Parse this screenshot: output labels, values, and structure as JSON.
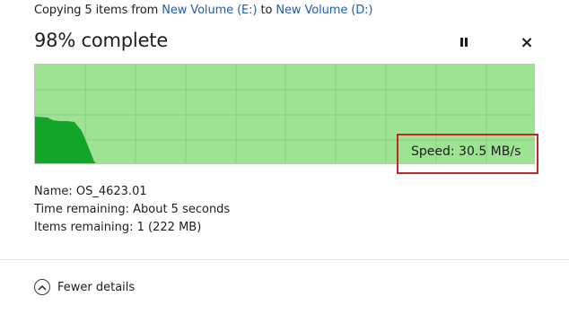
{
  "header": {
    "prefix": "Copying 5 items from",
    "source": "New Volume (E:)",
    "middle": "to",
    "destination": "New Volume (D:)"
  },
  "progress": {
    "label": "98% complete",
    "value": 0.98
  },
  "controls": {
    "pause_icon": "pause-icon",
    "close_icon": "close-icon",
    "close_glyph": "×"
  },
  "graph": {
    "speed_label": "Speed: 30.5 MB/s",
    "fill_color": "#9de393",
    "curve_color": "#12a52a",
    "highlight_color": "#c0282a"
  },
  "details": {
    "name": "Name: OS_4623.01",
    "time_remaining": "Time remaining: About 5 seconds",
    "items_remaining": "Items remaining: 1 (222 MB)"
  },
  "footer": {
    "toggle_label": "Fewer details",
    "toggle_icon": "chevron-up-icon"
  }
}
